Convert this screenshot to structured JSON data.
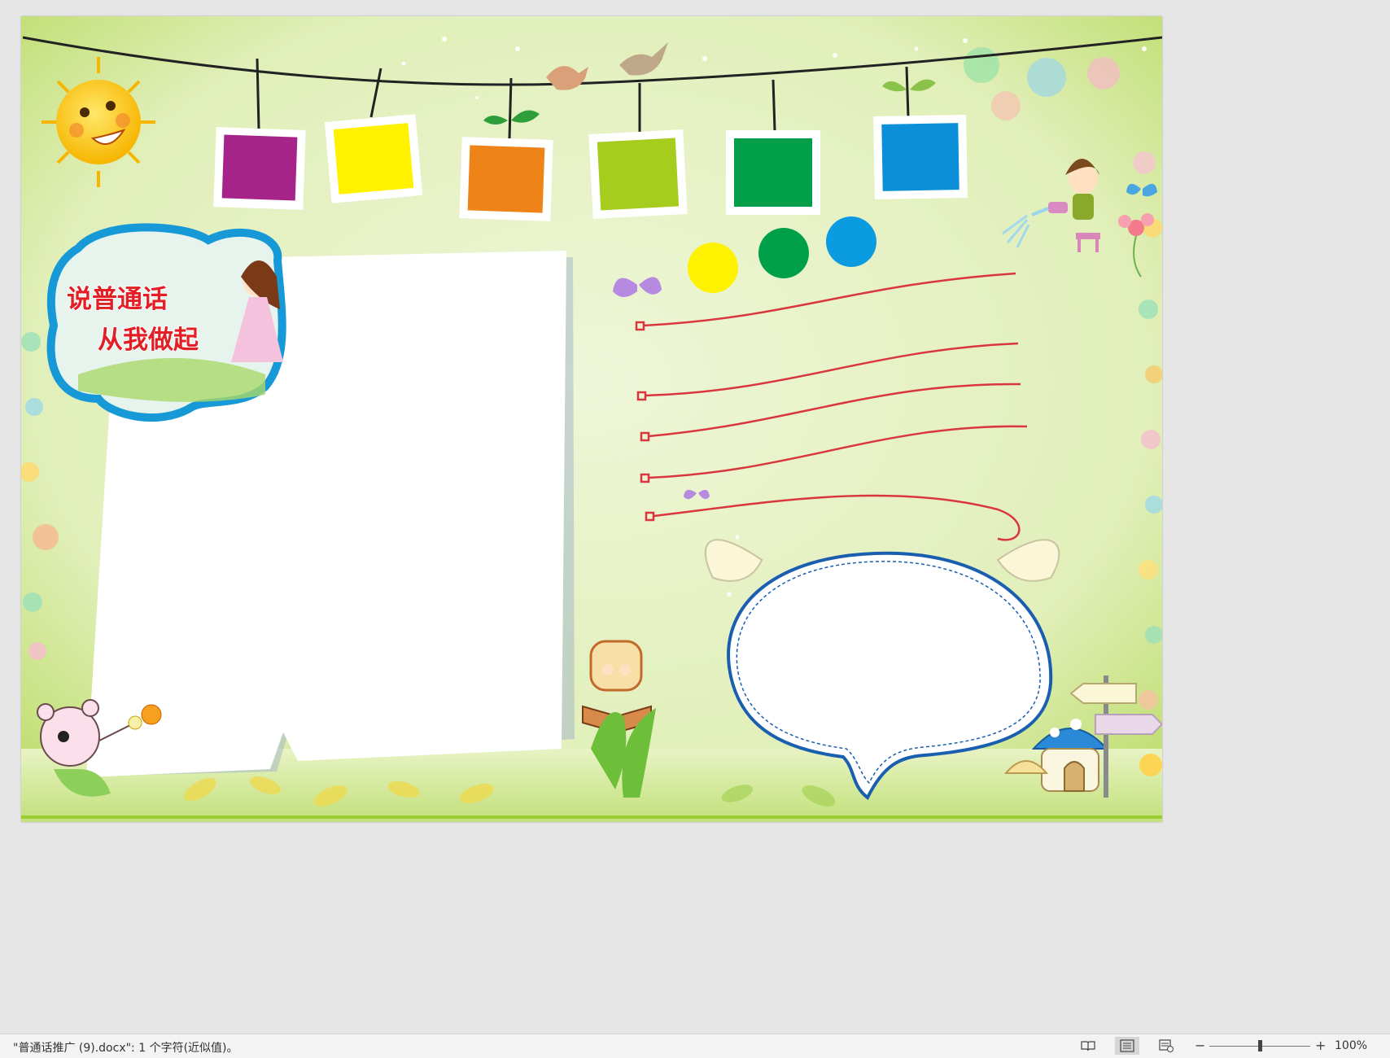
{
  "poster": {
    "title_line1": "说普通话",
    "title_line2": "从我做起"
  },
  "statusbar": {
    "status_text": "\"普通话推广 (9).docx\": 1 个字符(近似值)。",
    "zoom_minus": "−",
    "zoom_plus": "+",
    "zoom_level": "100%",
    "zoom_fraction": 0.5
  },
  "colors": {
    "page_bg": "#dfeeb2",
    "card_purple": "#a6238a",
    "card_yellow": "#fff200",
    "card_orange": "#ee8418",
    "card_lime": "#a6cc1e",
    "card_green": "#00a04a",
    "card_blue": "#0b8fd8",
    "dot_yellow": "#fff200",
    "dot_green": "#00a04a",
    "dot_blue": "#0b9be0",
    "line_red": "#d9363e",
    "bubble_border": "#1a5faf"
  },
  "icons": [
    "sun-icon",
    "bird-icon",
    "butterfly-icon",
    "flower-icon",
    "girl-illustration",
    "bear-illustration",
    "mushroom-house-icon",
    "signpost-icon",
    "book-icon",
    "read-mode-icon",
    "print-layout-icon",
    "web-layout-icon"
  ]
}
